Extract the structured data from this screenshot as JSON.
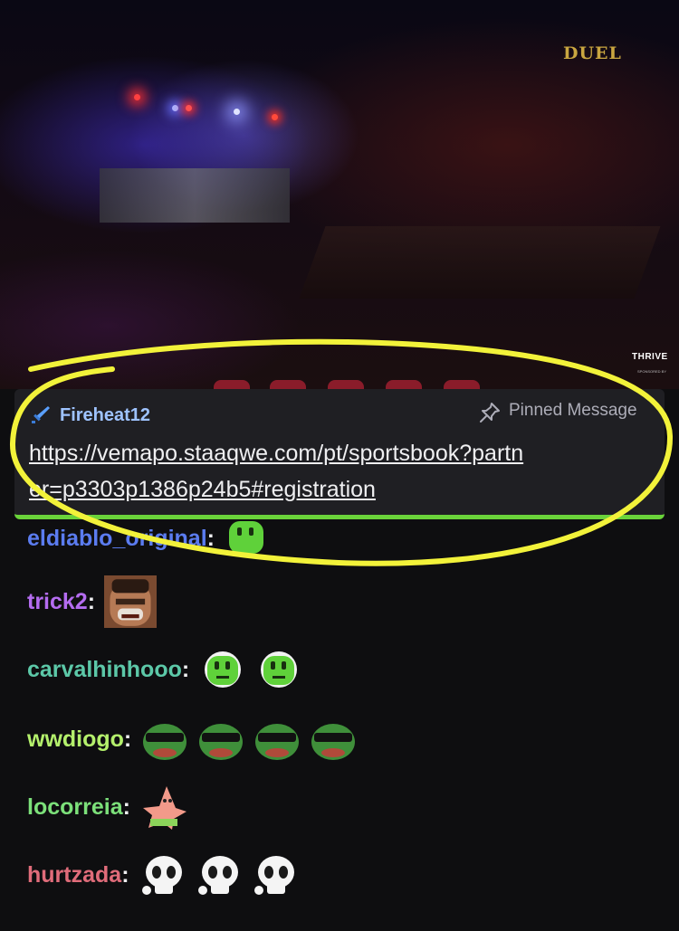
{
  "video": {
    "brand_logo": "DUEL",
    "sponsor": "THRIVE",
    "sponsor_sub": "SPONSORED BY"
  },
  "pinned_message": {
    "author": "Fireheat12",
    "author_color": "#9ec3ff",
    "badge_icon": "sword-icon",
    "label": "Pinned Message",
    "label_icon": "pushpin-icon",
    "link_line1": "https://vemapo.staaqwe.com/pt/sportsbook?partn",
    "link_line2": "er=p3303p1386p24b5#registration"
  },
  "chat": [
    {
      "user": "eldiablo_original",
      "color": "#5b7cf0",
      "emotes": [
        "green-blob-emote"
      ]
    },
    {
      "user": "trick2",
      "color": "#b46cf0",
      "emotes": [
        "laughing-man-emote"
      ]
    },
    {
      "user": "carvalhinhooo",
      "color": "#5cc8a8",
      "emotes": [
        "headset-blob-emote",
        "headset-blob-emote"
      ]
    },
    {
      "user": "wwdiogo",
      "color": "#b4f06c",
      "emotes": [
        "pepe-sunglasses-emote",
        "pepe-sunglasses-emote",
        "pepe-sunglasses-emote",
        "pepe-sunglasses-emote"
      ]
    },
    {
      "user": "locorreia",
      "color": "#7ce07a",
      "emotes": [
        "patrick-emote"
      ]
    },
    {
      "user": "hurtzada",
      "color": "#e06c7a",
      "emotes": [
        "skull-emote",
        "skull-emote",
        "skull-emote"
      ]
    }
  ],
  "annotation": {
    "color": "#f2f23a"
  }
}
